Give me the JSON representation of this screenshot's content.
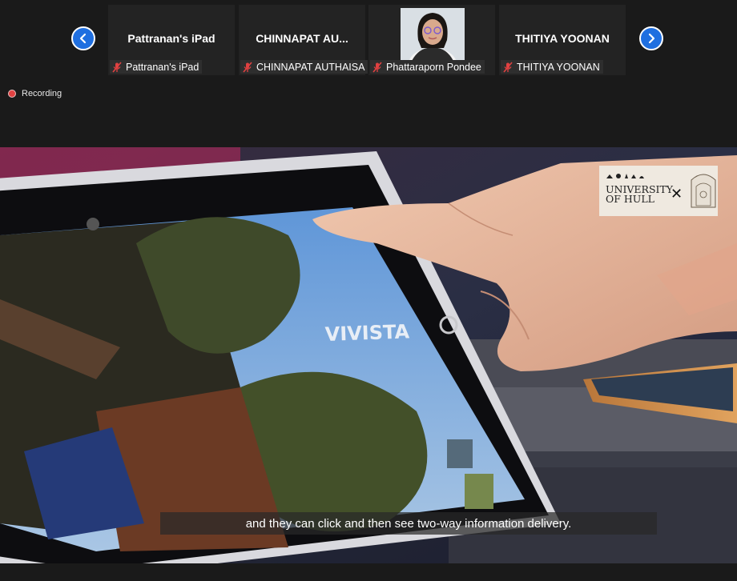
{
  "participants": [
    {
      "display": "Pattranan's iPad",
      "label": "Pattranan's iPad"
    },
    {
      "display": "CHINNAPAT AU...",
      "label": "CHINNAPAT AUTHAISA"
    },
    {
      "display": "",
      "label": "Phattaraporn Pondee"
    },
    {
      "display": "THITIYA YOONAN",
      "label": "THITIYA YOONAN"
    }
  ],
  "recording_label": "Recording",
  "caption": "and they can click and then see two-way information delivery.",
  "logo": {
    "line1": "UNIVERSITY",
    "line2": "OF HULL",
    "separator": "✕"
  },
  "video_overlay_text": "VIVISTA",
  "icons": {
    "prev": "chevron-left-icon",
    "next": "chevron-right-icon",
    "mic_muted": "mic-muted-icon"
  },
  "colors": {
    "accent": "#1f6fe0",
    "muted": "#e04141",
    "background": "#1a1a1a"
  }
}
